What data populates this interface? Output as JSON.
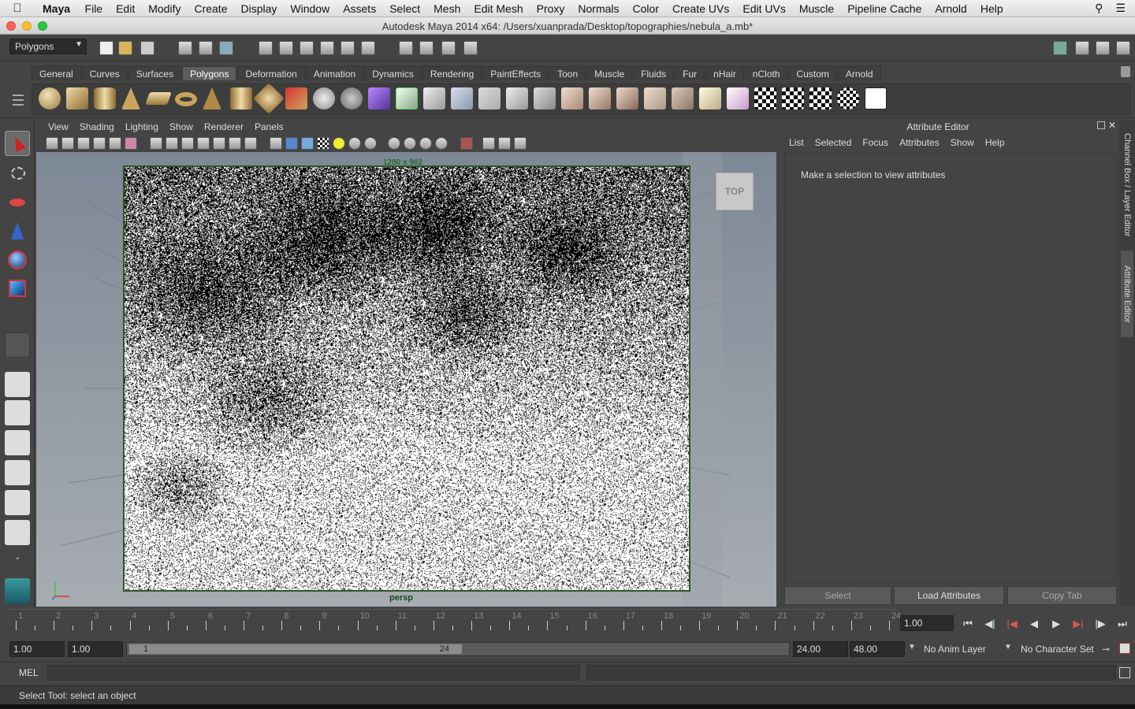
{
  "menubar": {
    "app": "Maya",
    "items": [
      "File",
      "Edit",
      "Modify",
      "Create",
      "Display",
      "Window",
      "Assets",
      "Select",
      "Mesh",
      "Edit Mesh",
      "Proxy",
      "Normals",
      "Color",
      "Create UVs",
      "Edit UVs",
      "Muscle",
      "Pipeline Cache",
      "Arnold",
      "Help"
    ]
  },
  "window": {
    "title": "Autodesk Maya 2014 x64: /Users/xuanprada/Desktop/topographies/nebula_a.mb*"
  },
  "statusline": {
    "menuset": "Polygons"
  },
  "shelf": {
    "tabs": [
      "General",
      "Curves",
      "Surfaces",
      "Polygons",
      "Deformation",
      "Animation",
      "Dynamics",
      "Rendering",
      "PaintEffects",
      "Toon",
      "Muscle",
      "Fluids",
      "Fur",
      "nHair",
      "nCloth",
      "Custom",
      "Arnold"
    ],
    "active": "Polygons"
  },
  "viewport": {
    "menu": [
      "View",
      "Shading",
      "Lighting",
      "Show",
      "Renderer",
      "Panels"
    ],
    "camera": "persp",
    "viewcube": "TOP",
    "resolution": "1280 x 962"
  },
  "attribute_editor": {
    "title": "Attribute Editor",
    "menu": [
      "List",
      "Selected",
      "Focus",
      "Attributes",
      "Show",
      "Help"
    ],
    "message": "Make a selection to view attributes",
    "buttons": [
      "Select",
      "Load Attributes",
      "Copy Tab"
    ],
    "side_tabs": [
      "Channel Box / Layer Editor",
      "Attribute Editor"
    ]
  },
  "timeslider": {
    "ticks": [
      "1",
      "2",
      "3",
      "4",
      "5",
      "6",
      "7",
      "8",
      "9",
      "10",
      "11",
      "12",
      "13",
      "14",
      "15",
      "16",
      "17",
      "18",
      "19",
      "20",
      "21",
      "22",
      "23",
      "24"
    ],
    "current_time": "1.00"
  },
  "range": {
    "start_time": "1.00",
    "playback_start": "1.00",
    "range_start_label": "1",
    "range_end_label": "24",
    "playback_end": "24.00",
    "end_time": "48.00",
    "anim_layer": "No Anim Layer",
    "character_set": "No Character Set"
  },
  "cmdline": {
    "label": "MEL"
  },
  "helpline": {
    "text": "Select Tool: select an object"
  }
}
